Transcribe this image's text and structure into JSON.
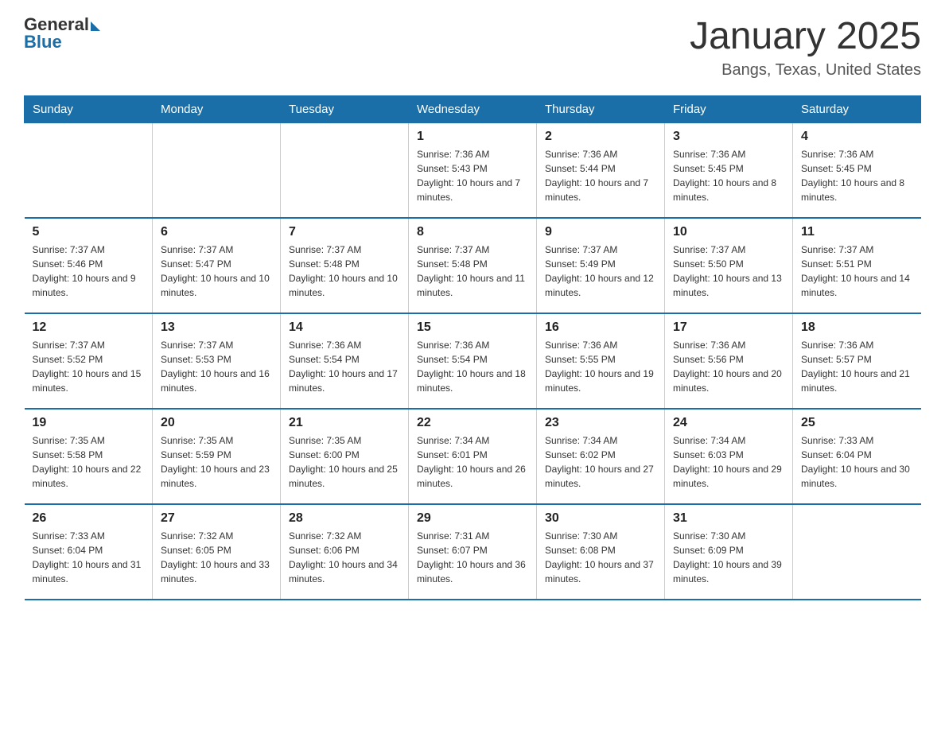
{
  "logo": {
    "general": "General",
    "blue": "Blue"
  },
  "title": "January 2025",
  "location": "Bangs, Texas, United States",
  "weekdays": [
    "Sunday",
    "Monday",
    "Tuesday",
    "Wednesday",
    "Thursday",
    "Friday",
    "Saturday"
  ],
  "weeks": [
    [
      {
        "day": "",
        "info": ""
      },
      {
        "day": "",
        "info": ""
      },
      {
        "day": "",
        "info": ""
      },
      {
        "day": "1",
        "info": "Sunrise: 7:36 AM\nSunset: 5:43 PM\nDaylight: 10 hours and 7 minutes."
      },
      {
        "day": "2",
        "info": "Sunrise: 7:36 AM\nSunset: 5:44 PM\nDaylight: 10 hours and 7 minutes."
      },
      {
        "day": "3",
        "info": "Sunrise: 7:36 AM\nSunset: 5:45 PM\nDaylight: 10 hours and 8 minutes."
      },
      {
        "day": "4",
        "info": "Sunrise: 7:36 AM\nSunset: 5:45 PM\nDaylight: 10 hours and 8 minutes."
      }
    ],
    [
      {
        "day": "5",
        "info": "Sunrise: 7:37 AM\nSunset: 5:46 PM\nDaylight: 10 hours and 9 minutes."
      },
      {
        "day": "6",
        "info": "Sunrise: 7:37 AM\nSunset: 5:47 PM\nDaylight: 10 hours and 10 minutes."
      },
      {
        "day": "7",
        "info": "Sunrise: 7:37 AM\nSunset: 5:48 PM\nDaylight: 10 hours and 10 minutes."
      },
      {
        "day": "8",
        "info": "Sunrise: 7:37 AM\nSunset: 5:48 PM\nDaylight: 10 hours and 11 minutes."
      },
      {
        "day": "9",
        "info": "Sunrise: 7:37 AM\nSunset: 5:49 PM\nDaylight: 10 hours and 12 minutes."
      },
      {
        "day": "10",
        "info": "Sunrise: 7:37 AM\nSunset: 5:50 PM\nDaylight: 10 hours and 13 minutes."
      },
      {
        "day": "11",
        "info": "Sunrise: 7:37 AM\nSunset: 5:51 PM\nDaylight: 10 hours and 14 minutes."
      }
    ],
    [
      {
        "day": "12",
        "info": "Sunrise: 7:37 AM\nSunset: 5:52 PM\nDaylight: 10 hours and 15 minutes."
      },
      {
        "day": "13",
        "info": "Sunrise: 7:37 AM\nSunset: 5:53 PM\nDaylight: 10 hours and 16 minutes."
      },
      {
        "day": "14",
        "info": "Sunrise: 7:36 AM\nSunset: 5:54 PM\nDaylight: 10 hours and 17 minutes."
      },
      {
        "day": "15",
        "info": "Sunrise: 7:36 AM\nSunset: 5:54 PM\nDaylight: 10 hours and 18 minutes."
      },
      {
        "day": "16",
        "info": "Sunrise: 7:36 AM\nSunset: 5:55 PM\nDaylight: 10 hours and 19 minutes."
      },
      {
        "day": "17",
        "info": "Sunrise: 7:36 AM\nSunset: 5:56 PM\nDaylight: 10 hours and 20 minutes."
      },
      {
        "day": "18",
        "info": "Sunrise: 7:36 AM\nSunset: 5:57 PM\nDaylight: 10 hours and 21 minutes."
      }
    ],
    [
      {
        "day": "19",
        "info": "Sunrise: 7:35 AM\nSunset: 5:58 PM\nDaylight: 10 hours and 22 minutes."
      },
      {
        "day": "20",
        "info": "Sunrise: 7:35 AM\nSunset: 5:59 PM\nDaylight: 10 hours and 23 minutes."
      },
      {
        "day": "21",
        "info": "Sunrise: 7:35 AM\nSunset: 6:00 PM\nDaylight: 10 hours and 25 minutes."
      },
      {
        "day": "22",
        "info": "Sunrise: 7:34 AM\nSunset: 6:01 PM\nDaylight: 10 hours and 26 minutes."
      },
      {
        "day": "23",
        "info": "Sunrise: 7:34 AM\nSunset: 6:02 PM\nDaylight: 10 hours and 27 minutes."
      },
      {
        "day": "24",
        "info": "Sunrise: 7:34 AM\nSunset: 6:03 PM\nDaylight: 10 hours and 29 minutes."
      },
      {
        "day": "25",
        "info": "Sunrise: 7:33 AM\nSunset: 6:04 PM\nDaylight: 10 hours and 30 minutes."
      }
    ],
    [
      {
        "day": "26",
        "info": "Sunrise: 7:33 AM\nSunset: 6:04 PM\nDaylight: 10 hours and 31 minutes."
      },
      {
        "day": "27",
        "info": "Sunrise: 7:32 AM\nSunset: 6:05 PM\nDaylight: 10 hours and 33 minutes."
      },
      {
        "day": "28",
        "info": "Sunrise: 7:32 AM\nSunset: 6:06 PM\nDaylight: 10 hours and 34 minutes."
      },
      {
        "day": "29",
        "info": "Sunrise: 7:31 AM\nSunset: 6:07 PM\nDaylight: 10 hours and 36 minutes."
      },
      {
        "day": "30",
        "info": "Sunrise: 7:30 AM\nSunset: 6:08 PM\nDaylight: 10 hours and 37 minutes."
      },
      {
        "day": "31",
        "info": "Sunrise: 7:30 AM\nSunset: 6:09 PM\nDaylight: 10 hours and 39 minutes."
      },
      {
        "day": "",
        "info": ""
      }
    ]
  ]
}
